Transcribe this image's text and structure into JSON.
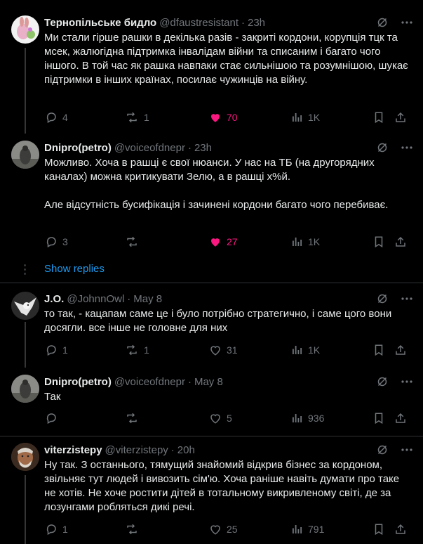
{
  "tweets": [
    {
      "name": "Тернопільське бидло",
      "handle": "@dfaustresistant",
      "time": "23h",
      "lines": [
        "Ми стали гірше рашки в декілька разів - закриті кордони, корупція тцк та мсек, жалюгідна підтримка інвалідам війни та списаним і багато чого іншого. В той час як рашка навпаки стає сильнішою та розумнішою, шукає підтримки в інших країнах, посилає чужинців на війну."
      ],
      "replies": "4",
      "reposts": "1",
      "likes": "70",
      "views": "1K",
      "liked": true
    },
    {
      "name": "Dnipro(petro)",
      "handle": "@voiceofdnepr",
      "time": "23h",
      "lines": [
        "Можливо. Хоча в рашці є свої нюанси. У нас на ТБ (на другорядних каналах) можна критикувати Зелю, а в рашці х%й.",
        "Але відсутність бусифікація і зачинені кордони багато чого перебиває."
      ],
      "replies": "3",
      "reposts": "",
      "likes": "27",
      "views": "1K",
      "liked": true
    },
    {
      "name": "J.O.",
      "handle": "@JohnnOwl",
      "time": "May 8",
      "lines": [
        "то так, -  кацапам саме це і було потрібно стратегично, і саме цого вони досягли. все інше не головне для них"
      ],
      "replies": "1",
      "reposts": "1",
      "likes": "31",
      "views": "1K",
      "liked": false
    },
    {
      "name": "Dnipro(petro)",
      "handle": "@voiceofdnepr",
      "time": "May 8",
      "lines": [
        "Так"
      ],
      "replies": "",
      "reposts": "",
      "likes": "5",
      "views": "936",
      "liked": false
    },
    {
      "name": "viterzistepy",
      "handle": "@viterzistepy",
      "time": "20h",
      "lines": [
        "Ну так. З останнього, тямущий знайомий відкрив бізнес за кордоном, звільняє тут людей і вивозить сім'ю. Хоча раніше навіть думати про таке не хотів. Не хоче ростити дітей в тотальному викривленому світі, де за лозунгами робляться дикі речі."
      ],
      "replies": "1",
      "reposts": "",
      "likes": "25",
      "views": "791",
      "liked": false
    }
  ],
  "show_replies": "Show replies",
  "colors": {
    "accent": "#1d9bf0",
    "like": "#f91880",
    "muted": "#71767b"
  },
  "icons": [
    "grok-icon",
    "more-icon",
    "reply-icon",
    "repost-icon",
    "like-icon",
    "views-icon",
    "bookmark-icon",
    "share-icon"
  ]
}
